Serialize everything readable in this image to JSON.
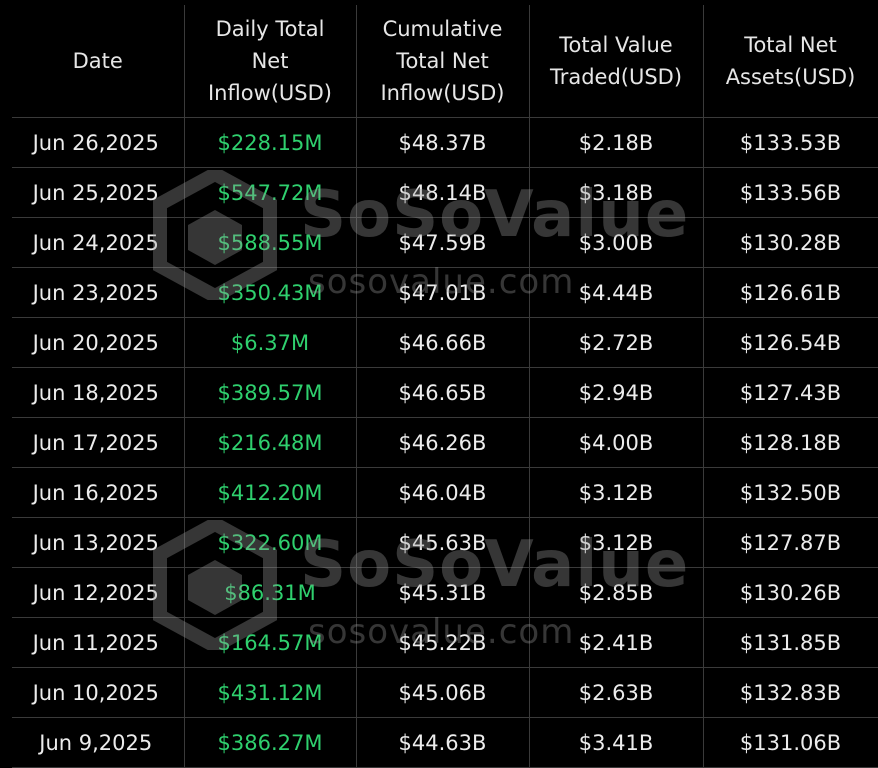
{
  "table": {
    "headers": [
      [
        "Date"
      ],
      [
        "Daily Total",
        "Net",
        "Inflow(USD)"
      ],
      [
        "Cumulative",
        "Total Net",
        "Inflow(USD)"
      ],
      [
        "Total Value",
        "Traded(USD)"
      ],
      [
        "Total Net",
        "Assets(USD)"
      ]
    ],
    "rows": [
      [
        "Jun 26,2025",
        "$228.15M",
        "$48.37B",
        "$2.18B",
        "$133.53B"
      ],
      [
        "Jun 25,2025",
        "$547.72M",
        "$48.14B",
        "$3.18B",
        "$133.56B"
      ],
      [
        "Jun 24,2025",
        "$588.55M",
        "$47.59B",
        "$3.00B",
        "$130.28B"
      ],
      [
        "Jun 23,2025",
        "$350.43M",
        "$47.01B",
        "$4.44B",
        "$126.61B"
      ],
      [
        "Jun 20,2025",
        "$6.37M",
        "$46.66B",
        "$2.72B",
        "$126.54B"
      ],
      [
        "Jun 18,2025",
        "$389.57M",
        "$46.65B",
        "$2.94B",
        "$127.43B"
      ],
      [
        "Jun 17,2025",
        "$216.48M",
        "$46.26B",
        "$4.00B",
        "$128.18B"
      ],
      [
        "Jun 16,2025",
        "$412.20M",
        "$46.04B",
        "$3.12B",
        "$132.50B"
      ],
      [
        "Jun 13,2025",
        "$322.60M",
        "$45.63B",
        "$3.12B",
        "$127.87B"
      ],
      [
        "Jun 12,2025",
        "$86.31M",
        "$45.31B",
        "$2.85B",
        "$130.26B"
      ],
      [
        "Jun 11,2025",
        "$164.57M",
        "$45.22B",
        "$2.41B",
        "$131.85B"
      ],
      [
        "Jun 10,2025",
        "$431.12M",
        "$45.06B",
        "$2.63B",
        "$132.83B"
      ],
      [
        "Jun 9,2025",
        "$386.27M",
        "$44.63B",
        "$3.41B",
        "$131.06B"
      ]
    ]
  },
  "watermark": {
    "brand": "SoSoValue",
    "url": "sosovalue.com",
    "icon": "sosovalue-logo-icon"
  },
  "colors": {
    "background": "#000000",
    "grid": "#3a3a3a",
    "text": "#ececec",
    "inflow_positive": "#2fd06e"
  }
}
